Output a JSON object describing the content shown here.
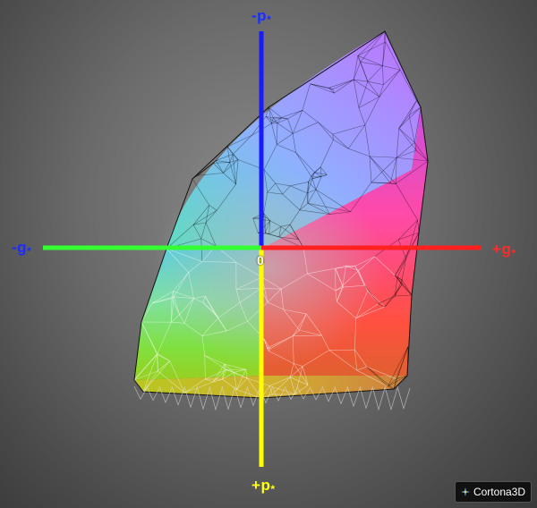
{
  "axes": {
    "neg_p": {
      "sign": "-",
      "letter": "p",
      "sub": "*"
    },
    "pos_p": {
      "sign": "+",
      "letter": "p",
      "sub": "*"
    },
    "neg_g": {
      "sign": "-",
      "letter": "g",
      "sub": "*"
    },
    "pos_g": {
      "sign": "+",
      "letter": "g",
      "sub": "*"
    },
    "origin": "0"
  },
  "colors": {
    "p_negative_axis": "#1a1aff",
    "p_positive_axis": "#ffff00",
    "g_negative_axis": "#33ff33",
    "g_positive_axis": "#ff2020",
    "mesh_dark": "#000000",
    "mesh_light": "#ffffff"
  },
  "brand": {
    "name": "Cortona3D"
  }
}
